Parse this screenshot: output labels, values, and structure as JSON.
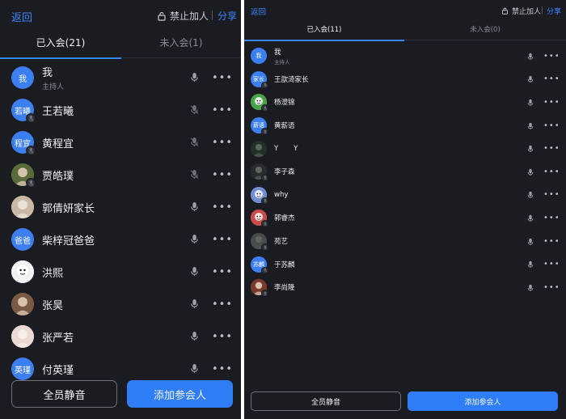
{
  "colors": {
    "background": "#1b1c21",
    "accent": "#3a86ff",
    "primary_button": "#2f7ef7",
    "divider": "#ffffff"
  },
  "left": {
    "header": {
      "back_label": "返回",
      "forbid_label": "禁止加人",
      "share_label": "分享"
    },
    "tabs": [
      {
        "label": "已入会(21)",
        "active": true
      },
      {
        "label": "未入会(1)",
        "active": false
      }
    ],
    "participants": [
      {
        "name": "我",
        "subtitle": "主持人",
        "avatar": {
          "type": "text",
          "text": "我",
          "color": "#3c7ff0"
        },
        "muted_badge": false,
        "mic_icon": "mic-icon"
      },
      {
        "name": "王若曦",
        "avatar": {
          "type": "text",
          "text": "若曦",
          "color": "#3c7ff0"
        },
        "muted_badge": true,
        "mic_icon": "mic-muted-icon"
      },
      {
        "name": "黄程宜",
        "avatar": {
          "type": "text",
          "text": "程宜",
          "color": "#3c7ff0"
        },
        "muted_badge": true,
        "mic_icon": "mic-muted-icon"
      },
      {
        "name": "贾皓璞",
        "avatar": {
          "type": "image",
          "image": "photo-alien-avatar",
          "color": "#5a6b3a"
        },
        "muted_badge": true,
        "mic_icon": "mic-muted-icon"
      },
      {
        "name": "郭倩妍家长",
        "avatar": {
          "type": "image",
          "image": "photo-cat-avatar",
          "color": "#c9b8a4"
        },
        "muted_badge": false,
        "mic_icon": "mic-icon"
      },
      {
        "name": "柴梓冠爸爸",
        "avatar": {
          "type": "text",
          "text": "爸爸",
          "color": "#3c7ff0"
        },
        "muted_badge": false,
        "mic_icon": "mic-icon"
      },
      {
        "name": "洪熙",
        "avatar": {
          "type": "image",
          "image": "photo-cartoon-avatar",
          "color": "#f2f2f2"
        },
        "muted_badge": false,
        "mic_icon": "mic-icon"
      },
      {
        "name": "张昊",
        "avatar": {
          "type": "image",
          "image": "photo-portrait-avatar",
          "color": "#7a5a44"
        },
        "muted_badge": false,
        "mic_icon": "mic-icon"
      },
      {
        "name": "张严若",
        "avatar": {
          "type": "image",
          "image": "photo-flower-avatar",
          "color": "#ead9d3"
        },
        "muted_badge": false,
        "mic_icon": "mic-icon"
      },
      {
        "name": "付英瑾",
        "avatar": {
          "type": "text",
          "text": "英瑾",
          "color": "#3c7ff0"
        },
        "muted_badge": false,
        "mic_icon": "mic-icon"
      }
    ],
    "buttons": {
      "mute_all": "全员静音",
      "add_participant": "添加参会人"
    }
  },
  "right": {
    "header": {
      "back_label": "返回",
      "forbid_label": "禁止加人",
      "share_label": "分享"
    },
    "tabs": [
      {
        "label": "已入会(11)",
        "active": true
      },
      {
        "label": "未入会(0)",
        "active": false
      }
    ],
    "participants": [
      {
        "name": "我",
        "subtitle": "主持人",
        "avatar": {
          "type": "text",
          "text": "我",
          "color": "#3c7ff0"
        },
        "muted_badge": false,
        "mic_icon": "mic-icon"
      },
      {
        "name": "王歆渏家长",
        "avatar": {
          "type": "text",
          "text": "家长",
          "color": "#3c7ff0"
        },
        "muted_badge": true,
        "mic_icon": "mic-icon"
      },
      {
        "name": "杨澄锦",
        "avatar": {
          "type": "image",
          "image": "photo-cartoon-avatar",
          "color": "#4aa34a"
        },
        "muted_badge": true,
        "mic_icon": "mic-icon"
      },
      {
        "name": "黄薪语",
        "avatar": {
          "type": "text",
          "text": "薪语",
          "color": "#3c7ff0"
        },
        "muted_badge": true,
        "mic_icon": "mic-icon"
      },
      {
        "name": "Y       Y",
        "avatar": {
          "type": "image",
          "image": "photo-dark-avatar",
          "color": "#26302a"
        },
        "muted_badge": false,
        "mic_icon": "mic-icon"
      },
      {
        "name": "李子森",
        "avatar": {
          "type": "image",
          "image": "photo-dark-avatar",
          "color": "#2b2b2b"
        },
        "muted_badge": true,
        "mic_icon": "mic-icon"
      },
      {
        "name": "why",
        "avatar": {
          "type": "image",
          "image": "photo-cartoon-avatar",
          "color": "#6f8fd0"
        },
        "muted_badge": true,
        "mic_icon": "mic-icon"
      },
      {
        "name": "郭睿杰",
        "avatar": {
          "type": "image",
          "image": "photo-cartoon-avatar",
          "color": "#c94b4b"
        },
        "muted_badge": true,
        "mic_icon": "mic-icon"
      },
      {
        "name": "苑艺",
        "avatar": {
          "type": "image",
          "image": "photo-dark-avatar",
          "color": "#4b4b4b"
        },
        "muted_badge": true,
        "mic_icon": "mic-icon"
      },
      {
        "name": "于苏麟",
        "avatar": {
          "type": "text",
          "text": "苏麟",
          "color": "#3c7ff0"
        },
        "muted_badge": true,
        "mic_icon": "mic-icon"
      },
      {
        "name": "李尚隆",
        "avatar": {
          "type": "image",
          "image": "photo-portrait-avatar",
          "color": "#7b3b2c"
        },
        "muted_badge": true,
        "mic_icon": "mic-icon"
      }
    ],
    "buttons": {
      "mute_all": "全员静音",
      "add_participant": "添加参会人"
    }
  }
}
